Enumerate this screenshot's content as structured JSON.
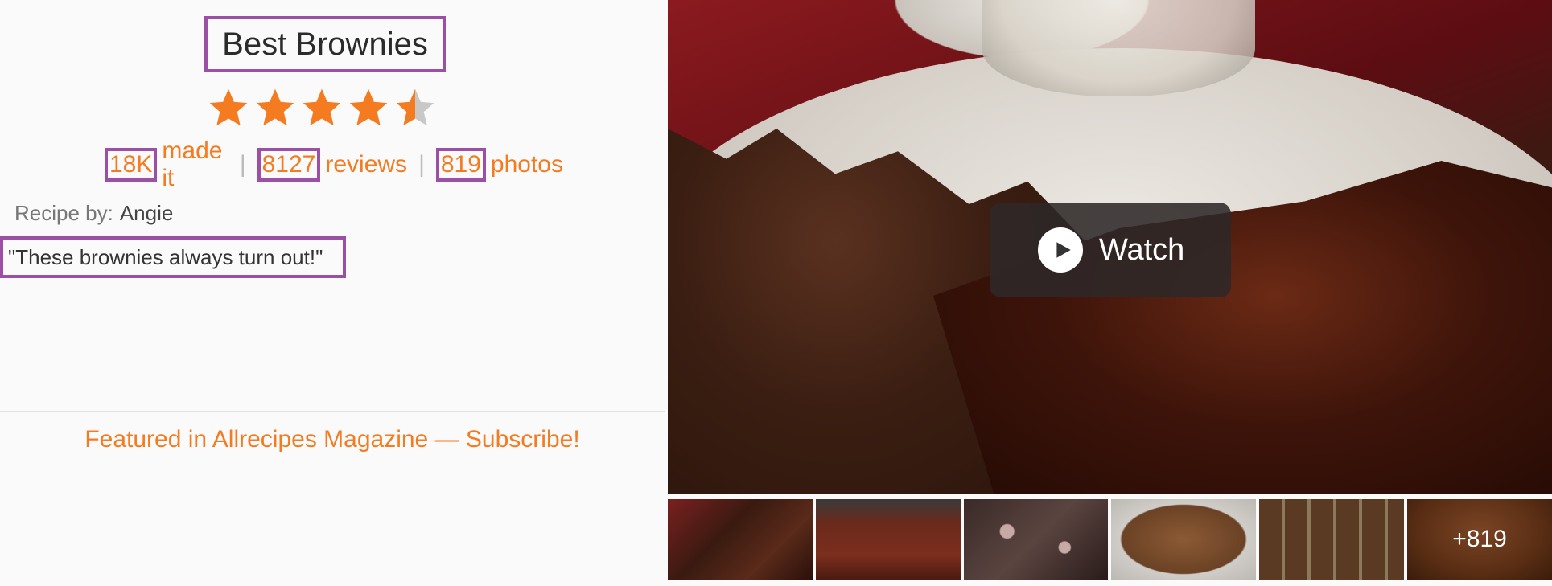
{
  "recipe": {
    "title": "Best Brownies",
    "rating": 4.5,
    "rating_max": 5,
    "made_count": "18K",
    "made_label": "made it",
    "reviews_count": "8127",
    "reviews_label": "reviews",
    "photos_count": "819",
    "photos_label": "photos",
    "separator": "|",
    "recipe_by_label": "Recipe by:",
    "author": "Angie",
    "quote": "\"These brownies always turn out!\"",
    "featured": "Featured in Allrecipes Magazine — Subscribe!"
  },
  "media": {
    "watch_label": "Watch",
    "more_photos": "+819"
  },
  "colors": {
    "accent": "#f47b20",
    "star": "#f47b20",
    "star_empty": "#c8c8c8",
    "highlight": "#9b4fa5"
  }
}
